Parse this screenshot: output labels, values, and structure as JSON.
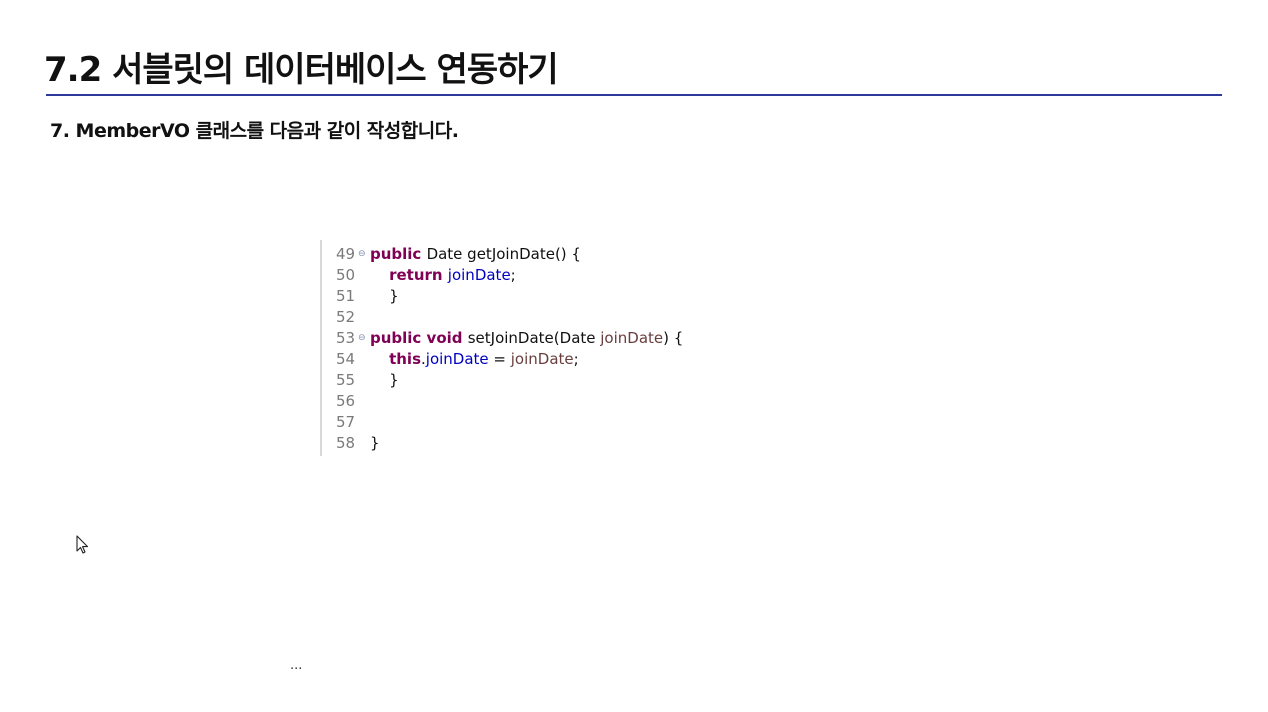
{
  "slide": {
    "title": "7.2 서블릿의 데이터베이스 연동하기",
    "step": "7. MemberVO 클래스를 다음과 같이 작성합니다."
  },
  "code": {
    "lines": [
      {
        "no": "49",
        "fold": "⊖",
        "tokens": [
          [
            "kw",
            "public "
          ],
          [
            "",
            "Date getJoinDate() {"
          ]
        ]
      },
      {
        "no": "50",
        "fold": "",
        "tokens": [
          [
            "",
            "    "
          ],
          [
            "kw",
            "return "
          ],
          [
            "field",
            "joinDate"
          ],
          [
            "",
            ";"
          ]
        ]
      },
      {
        "no": "51",
        "fold": "",
        "tokens": [
          [
            "",
            "    }"
          ]
        ]
      },
      {
        "no": "52",
        "fold": "",
        "tokens": []
      },
      {
        "no": "53",
        "fold": "⊖",
        "tokens": [
          [
            "kw",
            "public void "
          ],
          [
            "",
            "setJoinDate(Date "
          ],
          [
            "param",
            "joinDate"
          ],
          [
            "",
            ") {"
          ]
        ]
      },
      {
        "no": "54",
        "fold": "",
        "tokens": [
          [
            "",
            "    "
          ],
          [
            "kw",
            "this"
          ],
          [
            "",
            "."
          ],
          [
            "field",
            "joinDate"
          ],
          [
            "",
            " = "
          ],
          [
            "param",
            "joinDate"
          ],
          [
            "",
            ";"
          ]
        ]
      },
      {
        "no": "55",
        "fold": "",
        "tokens": [
          [
            "",
            "    }"
          ]
        ]
      },
      {
        "no": "56",
        "fold": "",
        "tokens": []
      },
      {
        "no": "57",
        "fold": "",
        "tokens": []
      },
      {
        "no": "58",
        "fold": "",
        "tokens": [
          [
            "",
            "}"
          ]
        ]
      }
    ]
  },
  "footer": {
    "ellipsis": "..."
  },
  "colors": {
    "rule": "#2b3a9a",
    "keyword": "#7f0055",
    "field": "#0000c0",
    "parameter": "#6a3e3e"
  },
  "icons": {
    "cursor": "mouse-pointer-icon"
  }
}
